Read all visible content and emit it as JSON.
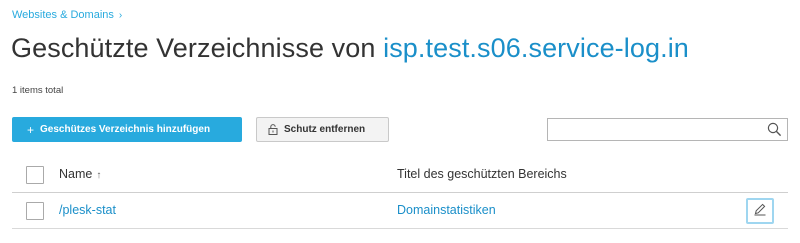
{
  "breadcrumb": {
    "label": "Websites & Domains",
    "separator": "›"
  },
  "page": {
    "title_prefix": "Geschützte Verzeichnisse von ",
    "title_domain": "isp.test.s06.service-log.in"
  },
  "summary": {
    "items_total": "1 items total"
  },
  "toolbar": {
    "add_label": "Geschützes Verzeichnis hinzufügen",
    "add_plus": "+",
    "remove_label": "Schutz entfernen",
    "search_value": ""
  },
  "table": {
    "columns": {
      "name": "Name",
      "name_sort": "↑",
      "title": "Titel des geschützten Bereichs"
    },
    "rows": [
      {
        "name": "/plesk-stat",
        "title": "Domainstatistiken"
      }
    ]
  },
  "colors": {
    "accent": "#28aade",
    "link": "#1a8fc9",
    "text": "#333333"
  },
  "icons": [
    "chevron-right-icon",
    "plus-icon",
    "lock-icon",
    "search-icon",
    "pencil-icon"
  ]
}
